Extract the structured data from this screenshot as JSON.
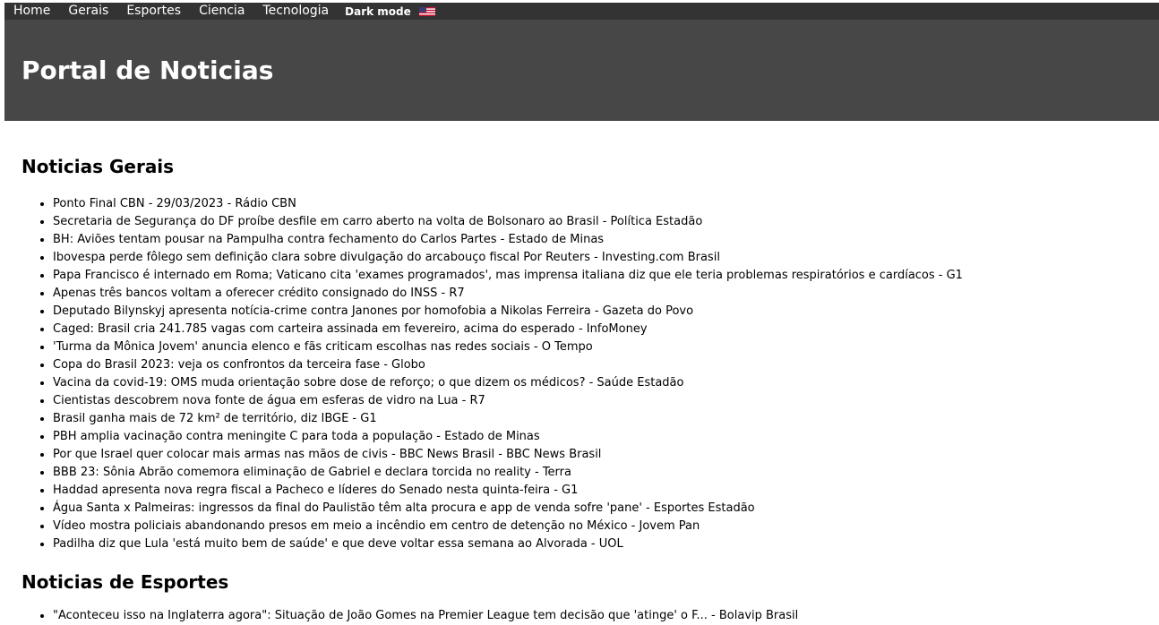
{
  "nav": {
    "home": "Home",
    "gerais": "Gerais",
    "esportes": "Esportes",
    "ciencia": "Ciencia",
    "tecnologia": "Tecnologia",
    "dark_mode": "Dark mode",
    "language_flag_icon": "us-flag-icon"
  },
  "header": {
    "title": "Portal de Noticias"
  },
  "sections": {
    "gerais": {
      "title": "Noticias Gerais",
      "items": [
        "Ponto Final CBN - 29/03/2023 - Rádio CBN",
        "Secretaria de Segurança do DF proíbe desfile em carro aberto na volta de Bolsonaro ao Brasil - Política Estadão",
        "BH: Aviões tentam pousar na Pampulha contra fechamento do Carlos Partes - Estado de Minas",
        "Ibovespa perde fôlego sem definição clara sobre divulgação do arcabouço fiscal Por Reuters - Investing.com Brasil",
        "Papa Francisco é internado em Roma; Vaticano cita 'exames programados', mas imprensa italiana diz que ele teria problemas respiratórios e cardíacos - G1",
        "Apenas três bancos voltam a oferecer crédito consignado do INSS - R7",
        "Deputado Bilynskyj apresenta notícia-crime contra Janones por homofobia a Nikolas Ferreira - Gazeta do Povo",
        "Caged: Brasil cria 241.785 vagas com carteira assinada em fevereiro, acima do esperado - InfoMoney",
        "'Turma da Mônica Jovem' anuncia elenco e fãs criticam escolhas nas redes sociais - O Tempo",
        "Copa do Brasil 2023: veja os confrontos da terceira fase - Globo",
        "Vacina da covid-19: OMS muda orientação sobre dose de reforço; o que dizem os médicos? - Saúde Estadão",
        "Cientistas descobrem nova fonte de água em esferas de vidro na Lua - R7",
        "Brasil ganha mais de 72 km² de território, diz IBGE - G1",
        "PBH amplia vacinação contra meningite C para toda a população - Estado de Minas",
        "Por que Israel quer colocar mais armas nas mãos de civis - BBC News Brasil - BBC News Brasil",
        "BBB 23: Sônia Abrão comemora eliminação de Gabriel e declara torcida no reality - Terra",
        "Haddad apresenta nova regra fiscal a Pacheco e líderes do Senado nesta quinta-feira - G1",
        "Água Santa x Palmeiras: ingressos da final do Paulistão têm alta procura e app de venda sofre 'pane' - Esportes Estadão",
        "Vídeo mostra policiais abandonando presos em meio a incêndio em centro de detenção no México - Jovem Pan",
        "Padilha diz que Lula 'está muito bem de saúde' e que deve voltar essa semana ao Alvorada - UOL"
      ]
    },
    "esportes": {
      "title": "Noticias de Esportes",
      "items": [
        "\"Aconteceu isso na Inglaterra agora\": Situação de João Gomes na Premier League tem decisão que 'atinge' o F... - Bolavip Brasil"
      ]
    }
  },
  "colors": {
    "nav_bg": "#333333",
    "header_bg": "#474747",
    "nav_text": "#ffffff"
  }
}
